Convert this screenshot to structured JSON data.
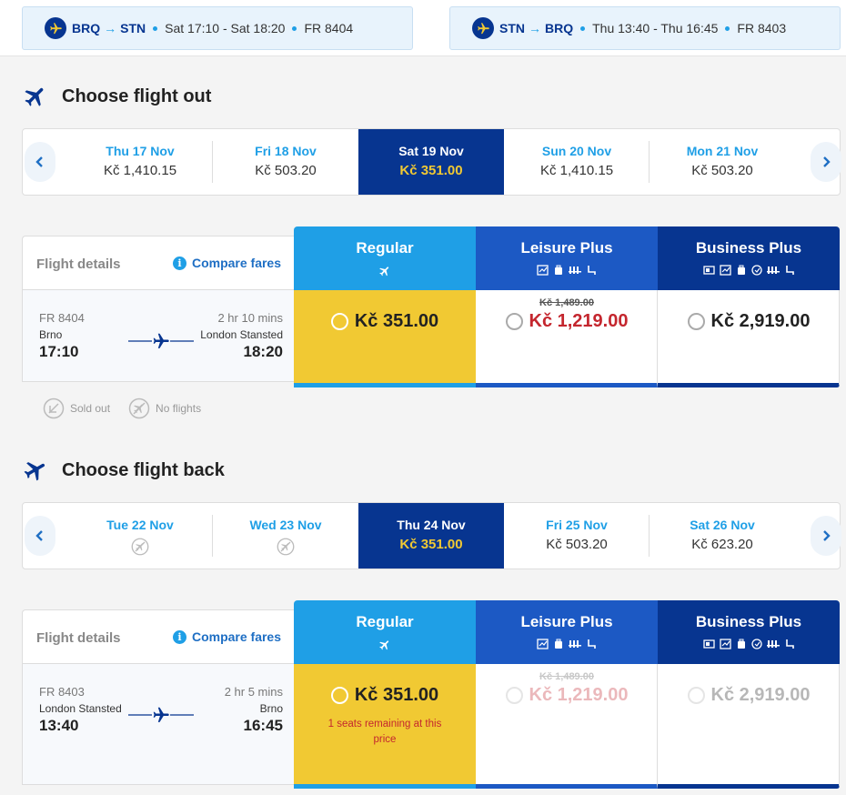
{
  "summary": {
    "outbound": {
      "from": "BRQ",
      "to": "STN",
      "times": "Sat 17:10 - Sat 18:20",
      "flight": "FR 8404"
    },
    "inbound": {
      "from": "STN",
      "to": "BRQ",
      "times": "Thu 13:40 - Thu 16:45",
      "flight": "FR 8403"
    }
  },
  "out": {
    "title": "Choose flight out",
    "dates": [
      {
        "day": "Thu 17 Nov",
        "price": "Kč 1,410.15"
      },
      {
        "day": "Fri 18 Nov",
        "price": "Kč 503.20"
      },
      {
        "day": "Sat 19 Nov",
        "price": "Kč 351.00"
      },
      {
        "day": "Sun 20 Nov",
        "price": "Kč 1,410.15"
      },
      {
        "day": "Mon 21 Nov",
        "price": "Kč 503.20"
      }
    ],
    "details_label": "Flight details",
    "compare_label": "Compare fares",
    "flight": {
      "number": "FR 8404",
      "duration": "2 hr 10 mins",
      "from": "Brno",
      "to": "London Stansted",
      "dep": "17:10",
      "arr": "18:20"
    },
    "fares": {
      "regular": {
        "name": "Regular",
        "price": "Kč 351.00"
      },
      "leisure": {
        "name": "Leisure Plus",
        "old_price": "Kč 1,489.00",
        "price": "Kč 1,219.00"
      },
      "business": {
        "name": "Business Plus",
        "price": "Kč 2,919.00"
      }
    }
  },
  "legend": {
    "sold_out": "Sold out",
    "no_flights": "No flights"
  },
  "back": {
    "title": "Choose flight back",
    "dates": [
      {
        "day": "Tue 22 Nov",
        "price": ""
      },
      {
        "day": "Wed 23 Nov",
        "price": ""
      },
      {
        "day": "Thu 24 Nov",
        "price": "Kč 351.00"
      },
      {
        "day": "Fri 25 Nov",
        "price": "Kč 503.20"
      },
      {
        "day": "Sat 26 Nov",
        "price": "Kč 623.20"
      }
    ],
    "details_label": "Flight details",
    "compare_label": "Compare fares",
    "flight": {
      "number": "FR 8403",
      "duration": "2 hr 5 mins",
      "from": "London Stansted",
      "to": "Brno",
      "dep": "13:40",
      "arr": "16:45"
    },
    "fares": {
      "regular": {
        "name": "Regular",
        "price": "Kč 351.00",
        "note": "1 seats remaining at this price"
      },
      "leisure": {
        "name": "Leisure Plus",
        "old_price": "Kč 1,489.00",
        "price": "Kč 1,219.00"
      },
      "business": {
        "name": "Business Plus",
        "price": "Kč 2,919.00"
      }
    }
  },
  "colors": {
    "brand_dark": "#073590",
    "brand_mid": "#1c59c4",
    "brand_light": "#1f9fe6",
    "selected_yellow": "#f1c933",
    "price_red": "#c4262e"
  }
}
